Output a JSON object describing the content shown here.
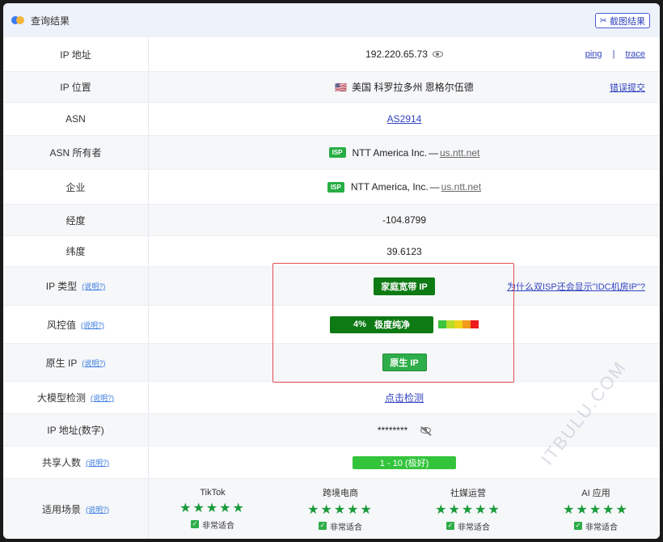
{
  "header": {
    "title": "查询结果",
    "screenshot_button": "截图结果"
  },
  "rows": {
    "ip": {
      "label": "IP 地址",
      "value": "192.220.65.73",
      "ping": "ping",
      "sep": "|",
      "trace": "trace"
    },
    "location": {
      "label": "IP 位置",
      "flag": "🇺🇸",
      "value": "美国 科罗拉多州 恩格尔伍德",
      "report": "错误提交"
    },
    "asn": {
      "label": "ASN",
      "value": "AS2914"
    },
    "asn_owner": {
      "label": "ASN 所有者",
      "badge": "ISP",
      "name": "NTT America Inc.",
      "dash": "—",
      "domain": "us.ntt.net"
    },
    "company": {
      "label": "企业",
      "badge": "ISP",
      "name": "NTT America, Inc.",
      "dash": "—",
      "domain": "us.ntt.net"
    },
    "longitude": {
      "label": "经度",
      "value": "-104.8799"
    },
    "latitude": {
      "label": "纬度",
      "value": "39.6123"
    },
    "ip_type": {
      "label": "IP 类型",
      "help": "(说明?)",
      "value": "家庭宽带 IP",
      "note": "为什么双ISP还会显示\"IDC机房IP\"?"
    },
    "risk": {
      "label": "风控值",
      "help": "(说明?)",
      "value": "4%",
      "text": "极度纯净",
      "percent": 4
    },
    "native": {
      "label": "原生 IP",
      "help": "(说明?)",
      "value": "原生 IP"
    },
    "llm": {
      "label": "大模型检测",
      "help": "(说明?)",
      "value": "点击检测"
    },
    "ip_numeric": {
      "label": "IP 地址(数字)",
      "value": "********"
    },
    "shared": {
      "label": "共享人数",
      "help": "(说明?)",
      "value": "1 - 10 (极好)"
    },
    "scenarios": {
      "label": "适用场景",
      "help": "(说明?)",
      "items": [
        {
          "name": "TikTok",
          "stars": "★★★★★",
          "rating": 5,
          "fit": "非常适合"
        },
        {
          "name": "跨境电商",
          "stars": "★★★★★",
          "rating": 5,
          "fit": "非常适合"
        },
        {
          "name": "社媒运营",
          "stars": "★★★★★",
          "rating": 5,
          "fit": "非常适合"
        },
        {
          "name": "AI 应用",
          "stars": "★★★★★",
          "rating": 5,
          "fit": "非常适合"
        }
      ]
    }
  },
  "watermark": "ITBULU.COM",
  "colors": {
    "accent": "#3344c0",
    "green_dark": "#0e7a14",
    "green": "#2eae4a",
    "shared_green": "#33c43c",
    "red_box": "#e35050"
  }
}
